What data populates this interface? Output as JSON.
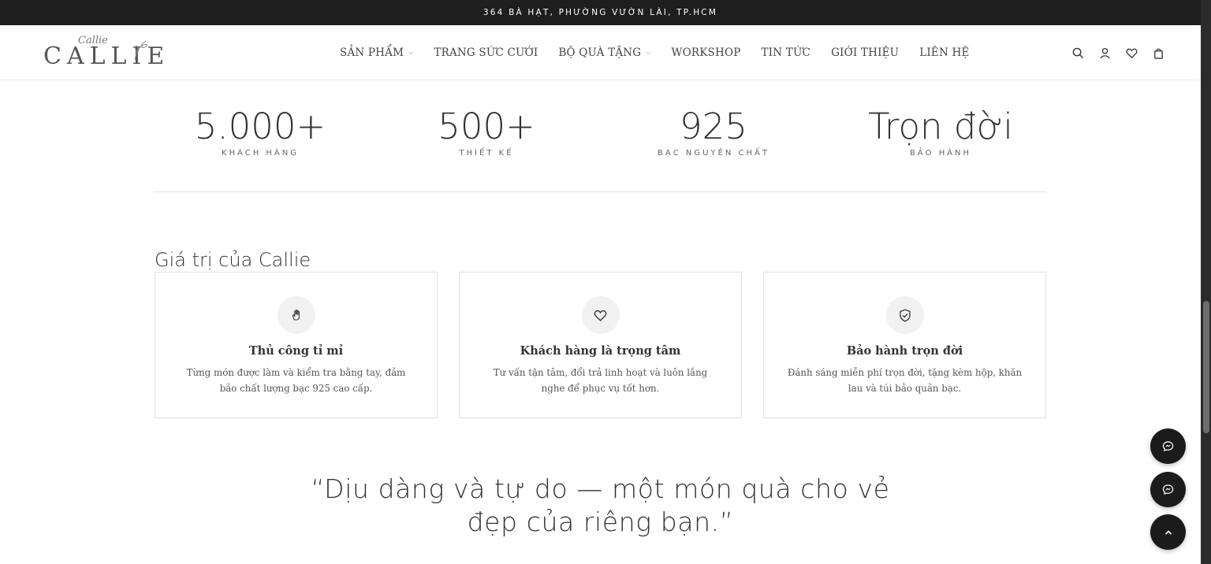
{
  "topbar": {
    "address": "364 BÀ HẠT, PHƯỜNG VƯỜN LÀI, TP.HCM"
  },
  "logo": {
    "word": "CALLIE",
    "script": "Callie"
  },
  "nav": {
    "items": [
      {
        "label": "SẢN PHẨM",
        "has_dropdown": true
      },
      {
        "label": "TRANG SỨC CƯỚI",
        "has_dropdown": false
      },
      {
        "label": "BỘ QUÀ TẶNG",
        "has_dropdown": true
      },
      {
        "label": "WORKSHOP",
        "has_dropdown": false
      },
      {
        "label": "TIN TỨC",
        "has_dropdown": false
      },
      {
        "label": "GIỚI THIỆU",
        "has_dropdown": false
      },
      {
        "label": "LIÊN HỆ",
        "has_dropdown": false
      }
    ],
    "icons": [
      "search-icon",
      "user-icon",
      "heart-icon",
      "shopping-bag-icon"
    ]
  },
  "stats": [
    {
      "value": "5.000+",
      "label": "KHÁCH HÀNG"
    },
    {
      "value": "500+",
      "label": "THIẾT KẾ"
    },
    {
      "value": "925",
      "label": "BẠC NGUYÊN CHẤT"
    },
    {
      "value": "Trọn đời",
      "label": "BẢO HÀNH"
    }
  ],
  "values": {
    "title": "Giá trị của Callie",
    "cards": [
      {
        "icon": "hand-icon",
        "title": "Thủ công tỉ mỉ",
        "desc": "Từng món được làm và kiểm tra bằng tay, đảm bảo chất lượng bạc 925 cao cấp."
      },
      {
        "icon": "heart-icon",
        "title": "Khách hàng là trọng tâm",
        "desc": "Tư vấn tận tâm, đổi trả linh hoạt và luôn lắng nghe để phục vụ tốt hơn."
      },
      {
        "icon": "shield-check-icon",
        "title": "Bảo hành trọn đời",
        "desc": "Đánh sáng miễn phí trọn đời, tặng kèm hộp, khăn lau và túi bảo quản bạc."
      }
    ]
  },
  "quote": "“Dịu dàng và tự do — một món quà cho vẻ đẹp của riêng bạn.”",
  "floating": [
    "chat-icon",
    "messenger-icon",
    "chevron-up-icon"
  ],
  "colors": {
    "topbar": "#1e1e1e",
    "text": "#333333",
    "float_button": "#1b1b1b"
  }
}
